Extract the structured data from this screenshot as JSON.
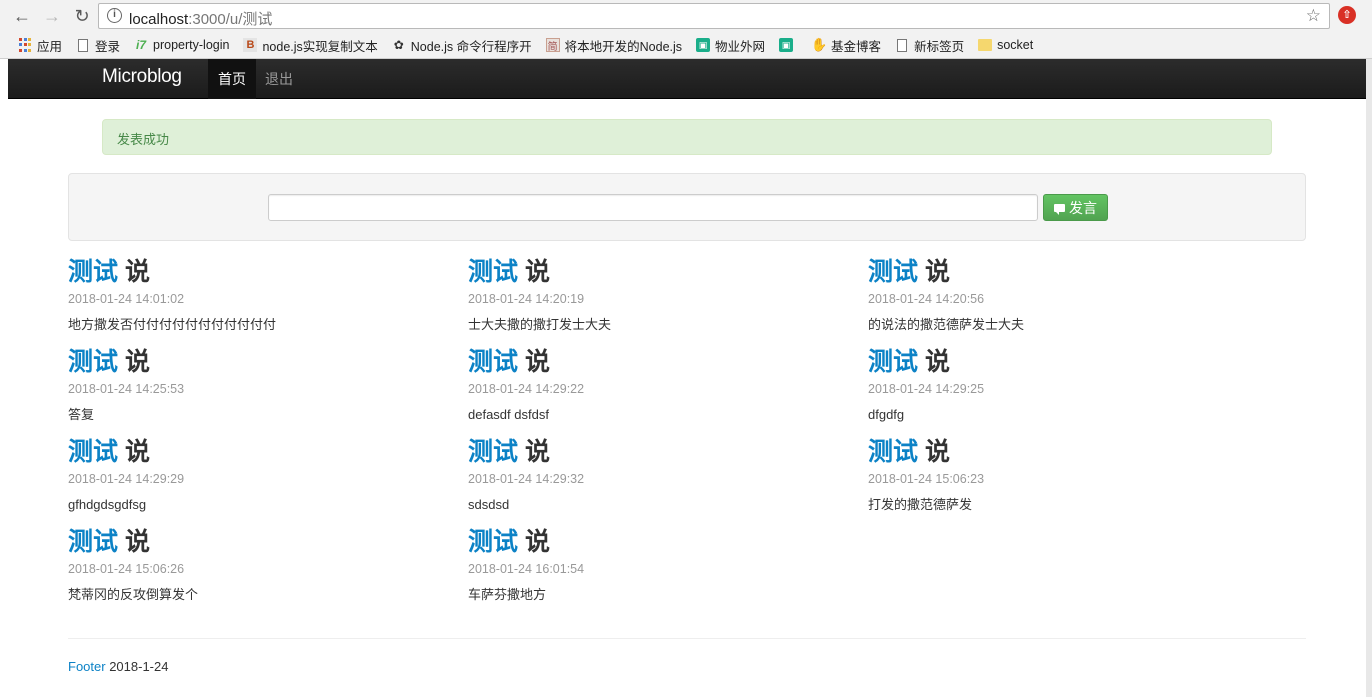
{
  "browser": {
    "url_host": "localhost",
    "url_rest": ":3000/u/测试",
    "bookmarks": [
      {
        "label": "应用",
        "icon": "apps-icon"
      },
      {
        "label": "登录",
        "icon": "page-icon"
      },
      {
        "label": "property-login",
        "icon": "lime-icon"
      },
      {
        "label": "node.js实现复制文本",
        "icon": "red-icon"
      },
      {
        "label": "Node.js 命令行程序开",
        "icon": "ink-icon"
      },
      {
        "label": "将本地开发的Node.js",
        "icon": "gray-icon"
      },
      {
        "label": "物业外网",
        "icon": "green-icon"
      },
      {
        "label": "",
        "icon": "green-icon"
      },
      {
        "label": "基金博客",
        "icon": "hand-icon"
      },
      {
        "label": "新标签页",
        "icon": "page-icon"
      },
      {
        "label": "socket",
        "icon": "folder-icon"
      }
    ]
  },
  "navbar": {
    "brand": "Microblog",
    "home": "首页",
    "logout": "退出"
  },
  "alert": {
    "text": "发表成功"
  },
  "post_form": {
    "input_value": "",
    "button_label": "发言"
  },
  "posts": [
    {
      "author": "测试",
      "says": "说",
      "time": "2018-01-24 14:01:02",
      "content": "地方撒发否付付付付付付付付付付付"
    },
    {
      "author": "测试",
      "says": "说",
      "time": "2018-01-24 14:20:19",
      "content": "士大夫撒的撒打发士大夫"
    },
    {
      "author": "测试",
      "says": "说",
      "time": "2018-01-24 14:20:56",
      "content": "的说法的撒范德萨发士大夫"
    },
    {
      "author": "测试",
      "says": "说",
      "time": "2018-01-24 14:25:53",
      "content": "答复"
    },
    {
      "author": "测试",
      "says": "说",
      "time": "2018-01-24 14:29:22",
      "content": "defasdf dsfdsf"
    },
    {
      "author": "测试",
      "says": "说",
      "time": "2018-01-24 14:29:25",
      "content": "dfgdfg"
    },
    {
      "author": "测试",
      "says": "说",
      "time": "2018-01-24 14:29:29",
      "content": "gfhdgdsgdfsg"
    },
    {
      "author": "测试",
      "says": "说",
      "time": "2018-01-24 14:29:32",
      "content": "sdsdsd"
    },
    {
      "author": "测试",
      "says": "说",
      "time": "2018-01-24 15:06:23",
      "content": "打发的撒范德萨发"
    },
    {
      "author": "测试",
      "says": "说",
      "time": "2018-01-24 15:06:26",
      "content": "梵蒂冈的反攻倒算发个"
    },
    {
      "author": "测试",
      "says": "说",
      "time": "2018-01-24 16:01:54",
      "content": "车萨芬撒地方"
    }
  ],
  "footer": {
    "link": "Footer",
    "date": "2018-1-24"
  }
}
